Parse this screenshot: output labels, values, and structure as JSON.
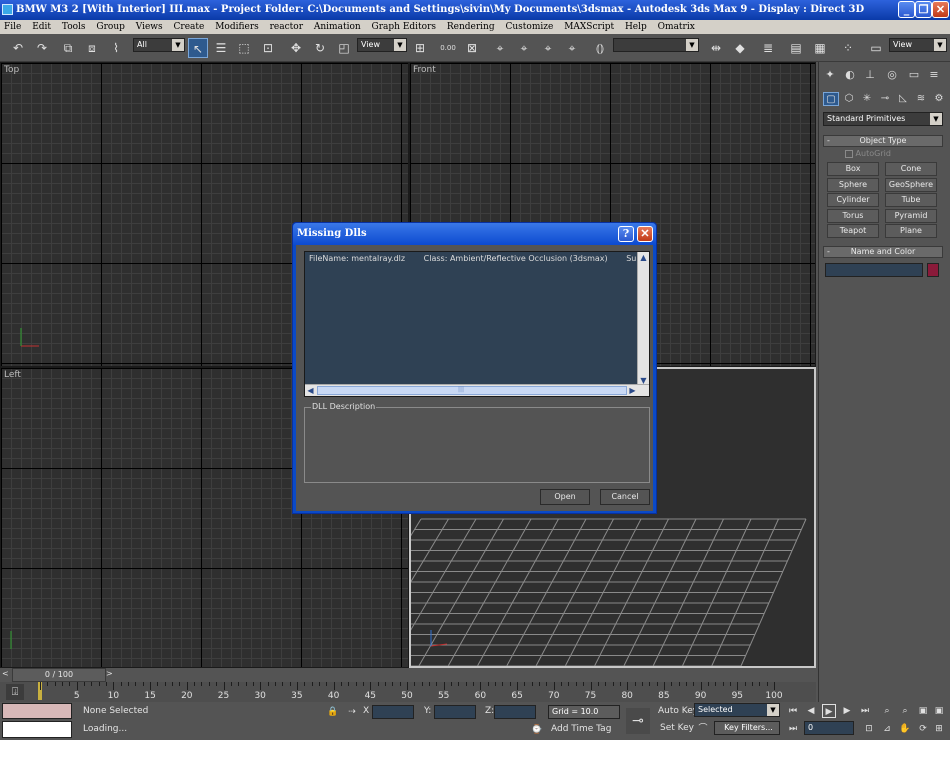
{
  "window": {
    "title": "BMW M3 2 [With Interior] III.max     - Project Folder: C:\\Documents and Settings\\sivin\\My Documents\\3dsmax     - Autodesk 3ds Max 9     - Display : Direct 3D",
    "min_icon": "_",
    "max_icon": "❐",
    "close_icon": "✕"
  },
  "menu": [
    "File",
    "Edit",
    "Tools",
    "Group",
    "Views",
    "Create",
    "Modifiers",
    "reactor",
    "Animation",
    "Graph Editors",
    "Rendering",
    "Customize",
    "MAXScript",
    "Help",
    "Omatrix"
  ],
  "toolbar": {
    "filter_value": "All",
    "ref_coord_value": "View",
    "named_selection_value": "",
    "view_right_value": "View",
    "angle_snap_label": "0.00"
  },
  "viewports": {
    "top": "Top",
    "front": "Front",
    "left": "Left",
    "perspective": ""
  },
  "command_panel": {
    "dropdown": "Standard Primitives",
    "object_type_title": "Object Type",
    "autogrid": "AutoGrid",
    "primitives": [
      "Box",
      "Cone",
      "Sphere",
      "GeoSphere",
      "Cylinder",
      "Tube",
      "Torus",
      "Pyramid",
      "Teapot",
      "Plane"
    ],
    "name_color_title": "Name and Color",
    "name_value": "",
    "color_swatch": "#8a1a3a"
  },
  "timeline": {
    "frame_counter": "0 / 100",
    "ticks": [
      "0",
      "5",
      "10",
      "15",
      "20",
      "25",
      "30",
      "35",
      "40",
      "45",
      "50",
      "55",
      "60",
      "65",
      "70",
      "75",
      "80",
      "85",
      "90",
      "95",
      "100"
    ]
  },
  "status": {
    "selection_text": "None Selected",
    "prompt_text": "Loading...",
    "x_label": "X",
    "y_label": "Y:",
    "z_label": "Z:",
    "x_value": "",
    "y_value": "",
    "z_value": "",
    "grid": "Grid = 10.0",
    "add_time_tag": "Add Time Tag",
    "auto_key": "Auto Key",
    "set_key": "Set Key",
    "key_mode_value": "Selected",
    "key_filters": "Key Filters...",
    "frame_value": "0"
  },
  "dialog": {
    "title": "Missing Dlls",
    "help_label": "?",
    "row": {
      "filename": "FileName:  mentalray.dlz",
      "class": "Class: Ambient/Reflective Occlusion (3dsmax)",
      "superclass": "SuperClass: Texturemap"
    },
    "scroll_grip": "|||",
    "description_label": "DLL Description",
    "open_button": "Open",
    "cancel_button": "Cancel"
  }
}
